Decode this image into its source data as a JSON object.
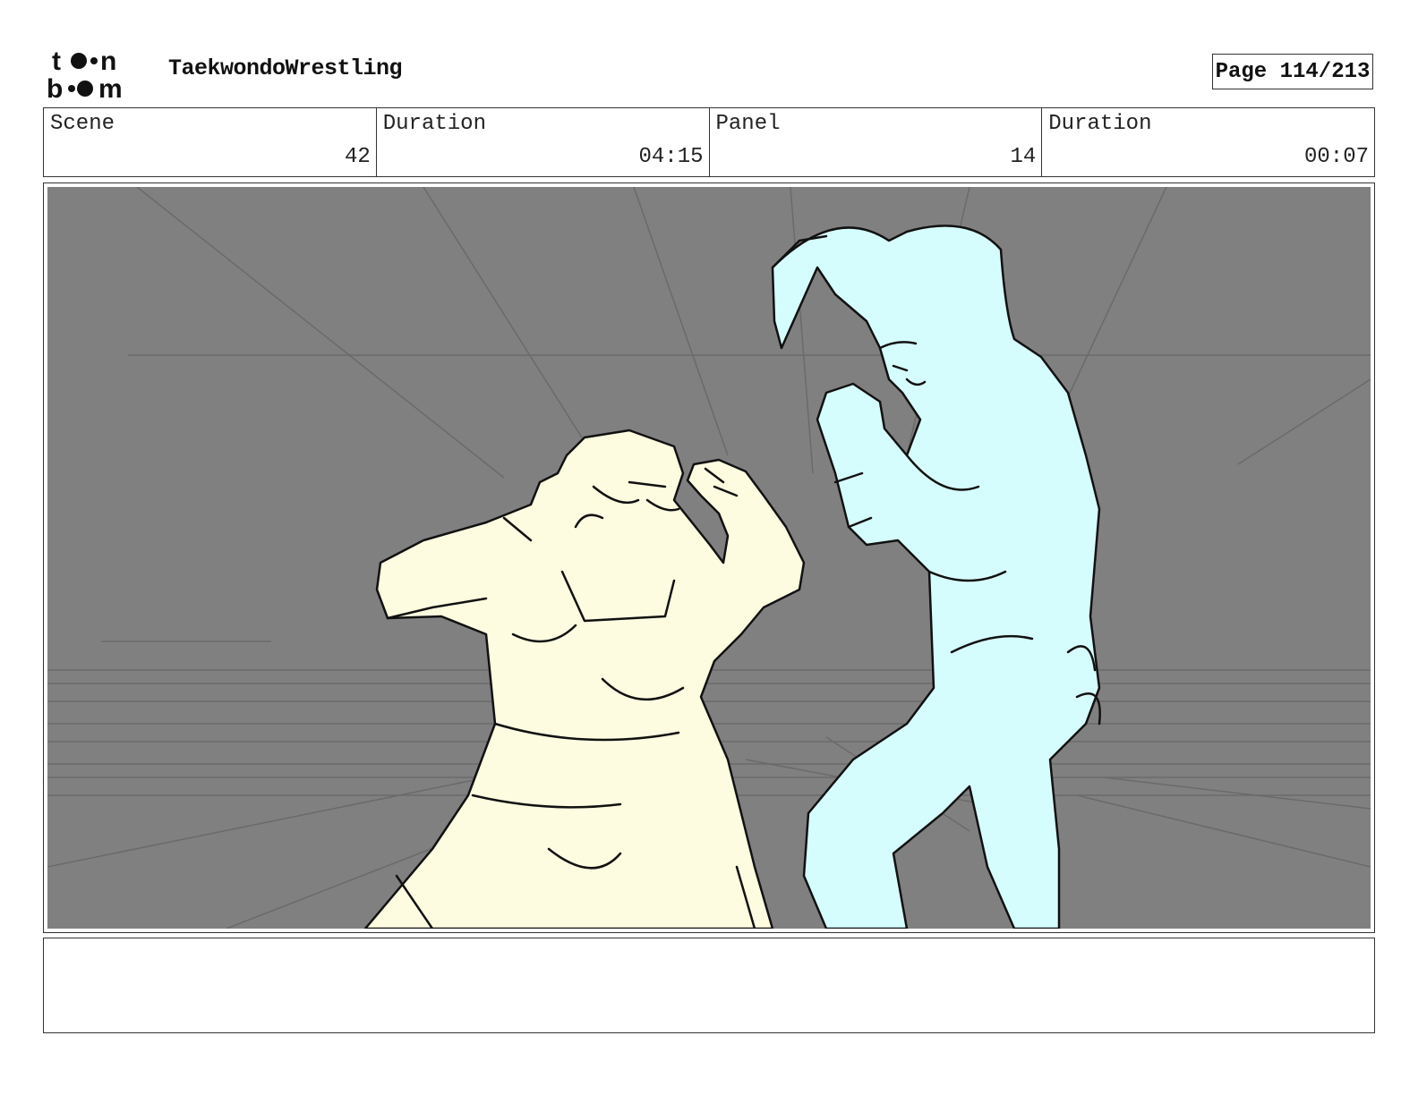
{
  "header": {
    "logo_text": "toon boom",
    "project_title": "TaekwondoWrestling",
    "page": "Page 114/213"
  },
  "info": {
    "scene_label": "Scene",
    "scene_value": "42",
    "scene_duration_label": "Duration",
    "scene_duration_value": "04:15",
    "panel_label": "Panel",
    "panel_value": "14",
    "panel_duration_label": "Duration",
    "panel_duration_value": "00:07"
  },
  "panel": {
    "colors": {
      "background": "#808080",
      "left_fighter_fill": "#fdfbe0",
      "right_fighter_fill": "#d6fdfd",
      "line": "#111111"
    }
  },
  "notes": {
    "text": ""
  }
}
